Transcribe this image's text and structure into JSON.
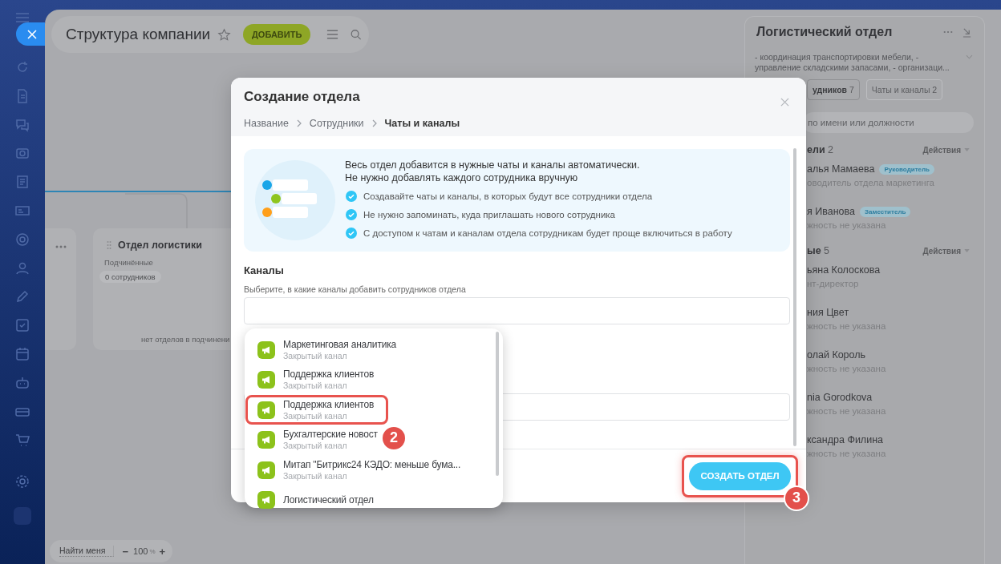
{
  "header": {
    "title": "Структура компании",
    "add_button": "ДОБАВИТЬ"
  },
  "canvas": {
    "nodes": [
      {
        "kind": "stub"
      },
      {
        "kind": "department",
        "title": "Отдел логистики",
        "subordinates_label": "Подчинённые",
        "count_badge": "0 сотрудников",
        "empty_note": "нет отделов в подчинени"
      }
    ]
  },
  "zoom_bar": {
    "find_me": "Найти меня",
    "decrease": "−",
    "value": "100",
    "unit": "%",
    "increase": "+"
  },
  "side_panel": {
    "title": "Логистический отдел",
    "description": "- координация транспортировки мебели, - управление складскими запасами, - организаци...",
    "tabs": [
      {
        "label": "удников",
        "count": "7",
        "selected": true
      },
      {
        "label": "Чаты и каналы",
        "count": "2",
        "selected": false
      }
    ],
    "search": {
      "placeholder": "по имени или должности"
    },
    "groups": [
      {
        "title": "ели",
        "count": "2",
        "action": "Действия",
        "members": [
          {
            "name": "алья Мамаева",
            "badge": "Руководитель",
            "position": "оводитель отдела маркетинга"
          },
          {
            "name": "я Иванова",
            "badge": "Заместитель",
            "position": "жность не указана"
          }
        ]
      },
      {
        "title": "ые",
        "count": "5",
        "action": "Действия",
        "members": [
          {
            "name": "ьяна Колоскова",
            "position": "нт-директор"
          },
          {
            "name": "ния Цвет",
            "position": "жность не указана"
          },
          {
            "name": "олай Король",
            "position": "жность не указана"
          },
          {
            "name": "nia Gorodkova",
            "position": "жность не указана"
          },
          {
            "name": "ксандра Филина",
            "position": "жность не указана"
          }
        ]
      }
    ]
  },
  "dialog": {
    "title": "Создание отдела",
    "breadcrumbs": [
      {
        "label": "Название",
        "selected": false
      },
      {
        "label": "Сотрудники",
        "selected": false
      },
      {
        "label": "Чаты и каналы",
        "selected": true
      }
    ],
    "info": {
      "lines": [
        "Весь отдел добавится в нужные чаты и каналы автоматически.",
        "Не нужно добавлять каждого сотрудника вручную"
      ],
      "points": [
        "Создавайте чаты и каналы, в которых будут все сотрудники отдела",
        "Не нужно запоминать, куда приглашать нового сотрудника",
        "С доступом к чатам и каналам отдела сотрудникам будет проще включиться в работу"
      ]
    },
    "channels": {
      "heading": "Каналы",
      "hint": "Выберите, в какие каналы добавить сотрудников отдела"
    },
    "dropdown": {
      "items": [
        {
          "name": "Маркетинговая аналитика",
          "type": "Закрытый канал"
        },
        {
          "name": "Поддержка клиентов",
          "type": "Закрытый канал"
        },
        {
          "name": "Поддержка клиентов",
          "type": "Закрытый канал",
          "callout": "2"
        },
        {
          "name": "Бухгалтерские новост",
          "type": "Закрытый канал"
        },
        {
          "name": "Митап \"Битрикс24 КЭДО: меньше бума...",
          "type": "Закрытый канал"
        },
        {
          "name": "Логистический отдел"
        }
      ]
    },
    "submit": {
      "label": "СОЗДАТЬ ОТДЕЛ",
      "callout": "3"
    }
  }
}
